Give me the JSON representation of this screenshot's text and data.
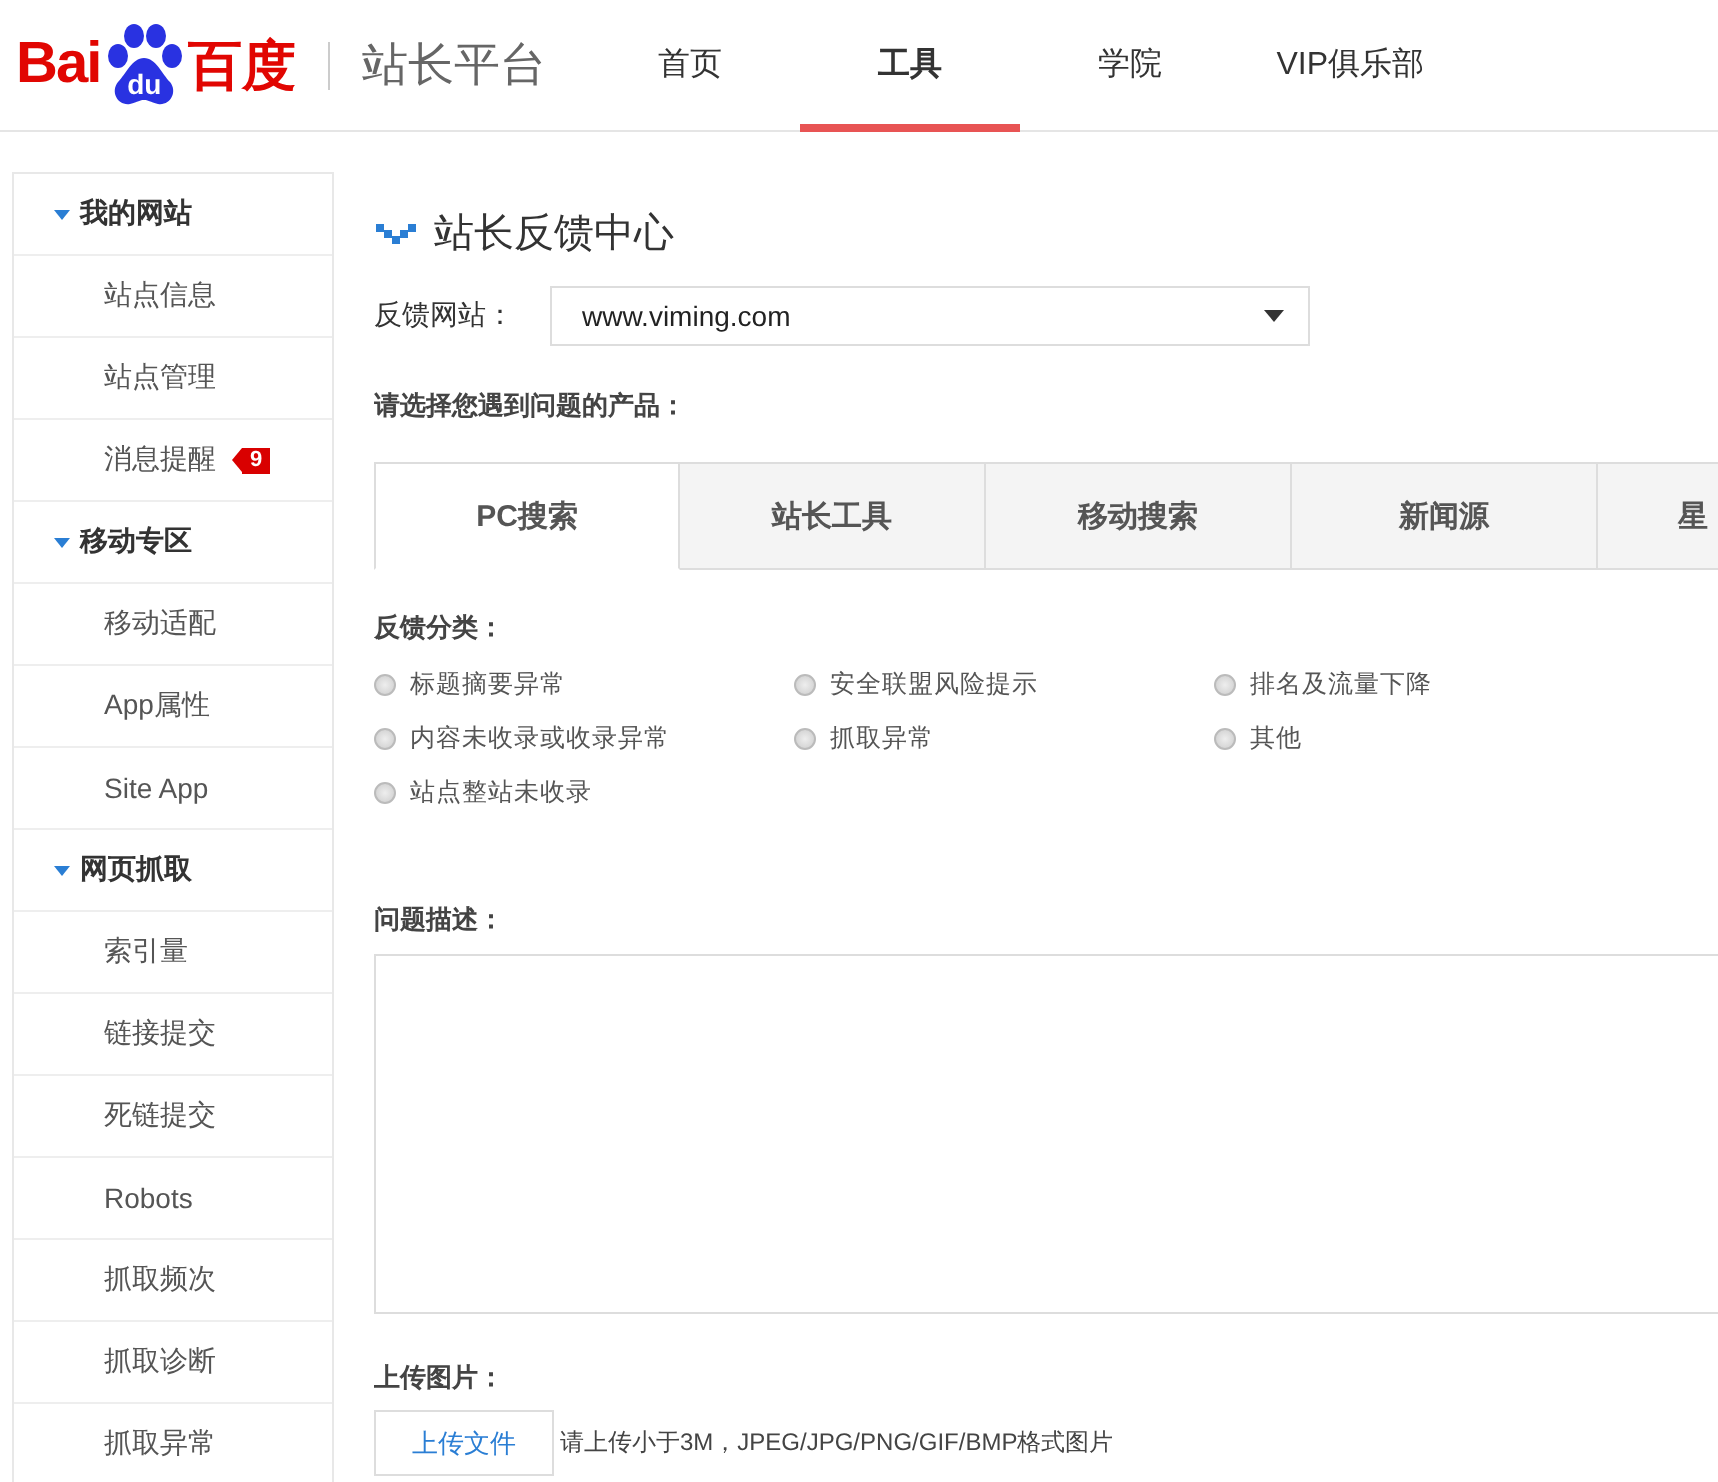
{
  "header": {
    "logo": {
      "latin": "Bai",
      "badge": "du",
      "chinese": "百度"
    },
    "site_title": "站长平台",
    "nav": [
      {
        "label": "首页",
        "selected": false
      },
      {
        "label": "工具",
        "selected": true
      },
      {
        "label": "学院",
        "selected": false
      },
      {
        "label": "VIP俱乐部",
        "selected": false
      }
    ]
  },
  "sidebar": {
    "groups": [
      {
        "label": "我的网站",
        "expanded": true,
        "children": [
          {
            "label": "站点信息"
          },
          {
            "label": "站点管理"
          },
          {
            "label": "消息提醒",
            "badge": "9"
          }
        ]
      },
      {
        "label": "移动专区",
        "expanded": true,
        "children": [
          {
            "label": "移动适配"
          },
          {
            "label": "App属性"
          },
          {
            "label": "Site App"
          }
        ]
      },
      {
        "label": "网页抓取",
        "expanded": true,
        "children": [
          {
            "label": "索引量"
          },
          {
            "label": "链接提交"
          },
          {
            "label": "死链提交"
          },
          {
            "label": "Robots"
          },
          {
            "label": "抓取频次"
          },
          {
            "label": "抓取诊断"
          },
          {
            "label": "抓取异常"
          }
        ]
      }
    ]
  },
  "main": {
    "title": "站长反馈中心",
    "site_field": {
      "label": "反馈网站：",
      "value": "www.viming.com"
    },
    "product_prompt": "请选择您遇到问题的产品：",
    "product_tabs": [
      {
        "label": "PC搜索",
        "selected": true
      },
      {
        "label": "站长工具",
        "selected": false
      },
      {
        "label": "移动搜索",
        "selected": false
      },
      {
        "label": "新闻源",
        "selected": false
      },
      {
        "label": "星",
        "selected": false
      }
    ],
    "category_label": "反馈分类：",
    "categories": [
      {
        "label": "标题摘要异常",
        "checked": false
      },
      {
        "label": "安全联盟风险提示",
        "checked": false
      },
      {
        "label": "排名及流量下降",
        "checked": false
      },
      {
        "label": "内容未收录或收录异常",
        "checked": false
      },
      {
        "label": "抓取异常",
        "checked": false
      },
      {
        "label": "其他",
        "checked": false
      },
      {
        "label": "站点整站未收录",
        "checked": false
      }
    ],
    "description_label": "问题描述：",
    "upload_label": "上传图片：",
    "upload_button": "上传文件",
    "upload_hint": "请上传小于3M，JPEG/JPG/PNG/GIF/BMP格式图片"
  }
}
